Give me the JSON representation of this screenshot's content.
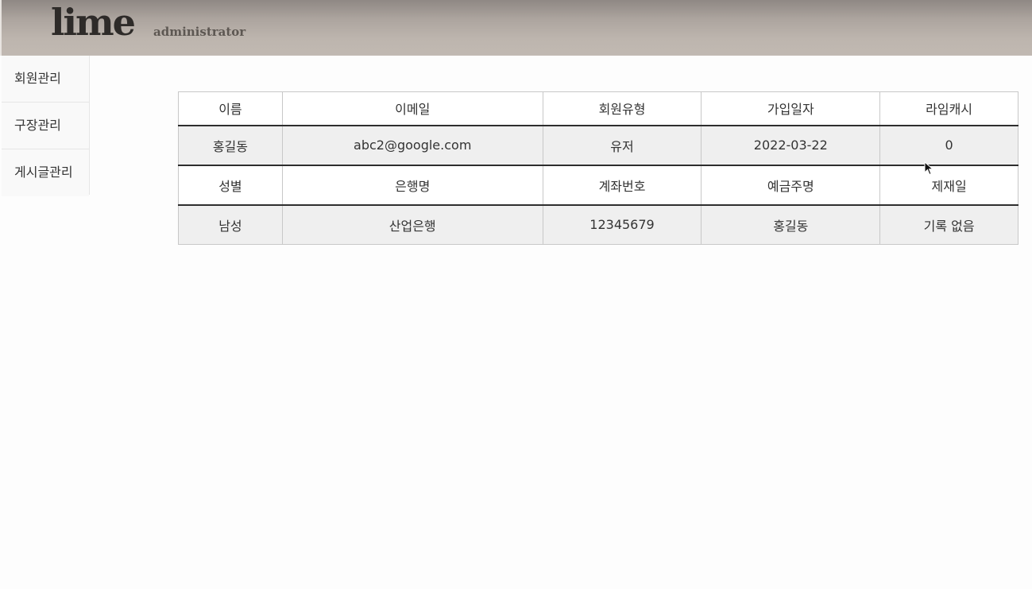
{
  "header": {
    "logo": "lime",
    "subtitle": "administrator"
  },
  "sidebar": {
    "items": [
      {
        "label": "회원관리"
      },
      {
        "label": "구장관리"
      },
      {
        "label": "게시글관리"
      }
    ]
  },
  "member_table": {
    "headers_1": [
      "이름",
      "이메일",
      "회원유형",
      "가입일자",
      "라임캐시"
    ],
    "values_1": [
      "홍길동",
      "abc2@google.com",
      "유저",
      "2022-03-22",
      "0"
    ],
    "headers_2": [
      "성별",
      "은행명",
      "계좌번호",
      "예금주명",
      "제재일"
    ],
    "values_2": [
      "남성",
      "산업은행",
      "12345679",
      "홍길동",
      "기록 없음"
    ]
  },
  "colors": {
    "header_gradient_top": "#8f8884",
    "header_gradient_bottom": "#c1b9b2",
    "value_row_bg": "#efefef",
    "row_divider": "#2e2e2e"
  }
}
